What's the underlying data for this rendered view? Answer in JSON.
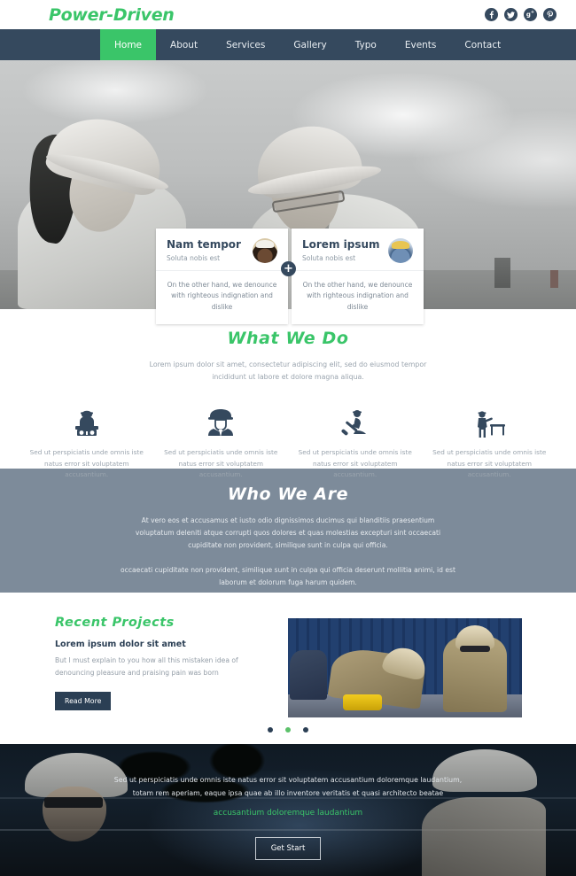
{
  "header": {
    "brand": "Power-Driven",
    "socials": [
      {
        "name": "facebook-icon",
        "glyph": "f"
      },
      {
        "name": "twitter-icon",
        "glyph": "t"
      },
      {
        "name": "google-plus-icon",
        "glyph": "g+"
      },
      {
        "name": "pinterest-icon",
        "glyph": "P"
      }
    ]
  },
  "nav": {
    "items": [
      {
        "label": "Home",
        "active": true
      },
      {
        "label": "About",
        "active": false
      },
      {
        "label": "Services",
        "active": false
      },
      {
        "label": "Gallery",
        "active": false
      },
      {
        "label": "Typo",
        "active": false
      },
      {
        "label": "Events",
        "active": false
      },
      {
        "label": "Contact",
        "active": false
      }
    ]
  },
  "hero": {
    "cards": [
      {
        "title": "Nam tempor",
        "subtitle": "Soluta nobis est",
        "body": "On the other hand, we denounce with righteous indignation and dislike"
      },
      {
        "title": "Lorem ipsum",
        "subtitle": "Soluta nobis est",
        "body": "On the other hand, we denounce with righteous indignation and dislike"
      }
    ],
    "plus_label": "+"
  },
  "what_we_do": {
    "title": "What We Do",
    "lead": "Lorem ipsum dolor sit amet, consectetur adipiscing elit, sed do eiusmod tempor incididunt ut labore et dolore magna aliqua.",
    "services": [
      {
        "icon": "worker-at-desk-icon",
        "text": "Sed ut perspiciatis unde omnis iste natus error sit voluptatem accusantium."
      },
      {
        "icon": "worker-helmet-icon",
        "text": "Sed ut perspiciatis unde omnis iste natus error sit voluptatem accusantium."
      },
      {
        "icon": "worker-digging-icon",
        "text": "Sed ut perspiciatis unde omnis iste natus error sit voluptatem accusantium."
      },
      {
        "icon": "worker-presenting-icon",
        "text": "Sed ut perspiciatis unde omnis iste natus error sit voluptatem accusantium."
      }
    ]
  },
  "who_we_are": {
    "title": "Who We Are",
    "paragraph1": "At vero eos et accusamus et iusto odio dignissimos ducimus qui blanditiis praesentium voluptatum deleniti atque corrupti quos dolores et quas molestias excepturi sint occaecati cupiditate non provident, similique sunt in culpa qui officia.",
    "paragraph2": "occaecati cupiditate non provident, similique sunt in culpa qui officia deserunt mollitia animi, id est laborum et dolorum fuga harum quidem."
  },
  "recent_projects": {
    "title": "Recent Projects",
    "subtitle": "Lorem ipsum dolor sit amet",
    "paragraph": "But I must explain to you how all this mistaken idea of denouncing pleasure and praising pain was born",
    "read_more_label": "Read More",
    "carousel_dots": [
      {
        "active": false
      },
      {
        "active": true
      },
      {
        "active": false
      }
    ]
  },
  "cta": {
    "paragraph": "Sed ut perspiciatis unde omnis iste natus error sit voluptatem accusantium doloremque laudantium, totam rem aperiam, eaque ipsa quae ab illo inventore veritatis et quasi architecto beatae",
    "highlight": "accusantium doloremque laudantium",
    "button_label": "Get Start"
  },
  "colors": {
    "brand_green": "#3ac569",
    "navy": "#35495e",
    "slate": "#7d8b9a",
    "muted_text": "#9aa4ae",
    "dark_button": "#2b3f54"
  }
}
